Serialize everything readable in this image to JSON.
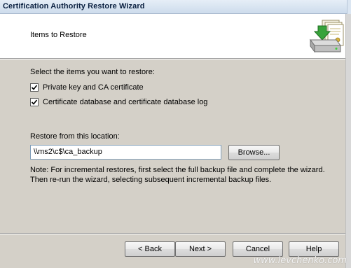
{
  "window": {
    "title": "Certification Authority Restore Wizard"
  },
  "header": {
    "title": "Items to Restore",
    "icon": "restore-wizard-icon"
  },
  "main": {
    "prompt": "Select the items you want to restore:",
    "options": [
      {
        "label": "Private key and CA certificate",
        "checked": true
      },
      {
        "label": "Certificate database and certificate database log",
        "checked": true
      }
    ],
    "location_label": "Restore from this location:",
    "location_value": "\\\\ms2\\c$\\ca_backup",
    "browse_label": "Browse...",
    "note": "Note: For incremental restores, first select the full backup file and complete the wizard. Then re-run the wizard, selecting subsequent incremental backup files."
  },
  "footer": {
    "back_label": "< Back",
    "next_label": "Next >",
    "cancel_label": "Cancel",
    "help_label": "Help"
  },
  "watermark": "www.levchenko.com",
  "colors": {
    "dialog_bg": "#d4d0c8",
    "header_bg": "#ffffff",
    "titlebar": "#dbe6f2"
  }
}
